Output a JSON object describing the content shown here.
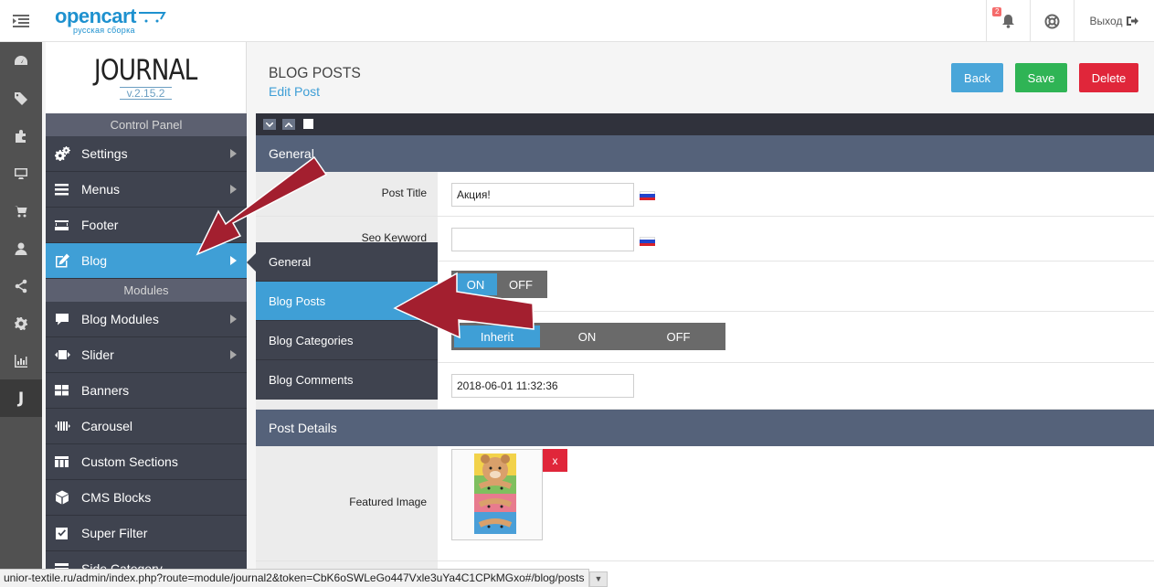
{
  "header": {
    "logo_main": "opencart",
    "logo_sub": "русская сборка",
    "notifications_count": "2",
    "logout_label": "Выход"
  },
  "icon_sidebar": [
    "dashboard-icon",
    "tag-icon",
    "puzzle-icon",
    "monitor-icon",
    "cart-icon",
    "user-icon",
    "share-icon",
    "gear-icon",
    "bar-chart-icon",
    "journal-icon"
  ],
  "journal": {
    "title": "JOURNAL",
    "version": "v.2.15.2",
    "section_control": "Control Panel",
    "section_modules": "Modules",
    "control_items": [
      {
        "label": "Settings",
        "icon": "gears-icon"
      },
      {
        "label": "Menus",
        "icon": "bars-icon"
      },
      {
        "label": "Footer",
        "icon": "footer-icon"
      },
      {
        "label": "Blog",
        "icon": "edit-icon"
      }
    ],
    "module_items": [
      {
        "label": "Blog Modules",
        "icon": "comment-icon"
      },
      {
        "label": "Slider",
        "icon": "slider-icon"
      },
      {
        "label": "Banners",
        "icon": "grid-icon"
      },
      {
        "label": "Carousel",
        "icon": "carousel-icon"
      },
      {
        "label": "Custom Sections",
        "icon": "sections-icon"
      },
      {
        "label": "CMS Blocks",
        "icon": "cube-icon"
      },
      {
        "label": "Super Filter",
        "icon": "checkbox-icon"
      },
      {
        "label": "Side Category",
        "icon": "list-icon"
      }
    ]
  },
  "page": {
    "title": "BLOG POSTS",
    "subtitle": "Edit Post",
    "back_label": "Back",
    "save_label": "Save",
    "delete_label": "Delete"
  },
  "flyout": {
    "items": [
      "General",
      "Blog Posts",
      "Blog Categories",
      "Blog Comments"
    ]
  },
  "general": {
    "heading": "General",
    "post_title_label": "Post Title",
    "post_title_value": "Акция!",
    "seo_label": "Seo Keyword",
    "seo_value": "",
    "status_on": "ON",
    "status_off": "OFF",
    "comments_inherit": "Inherit",
    "comments_on": "ON",
    "comments_off": "OFF",
    "date_value": "2018-06-01 11:32:36"
  },
  "post_details": {
    "heading": "Post Details",
    "featured_image_label": "Featured Image",
    "remove_label": "x"
  },
  "status_url": "unior-textile.ru/admin/index.php?route=module/journal2&token=CbK6oSWLeGo447Vxle3uYa4C1CPkMGxo#/blog/posts",
  "colors": {
    "accent": "#3f9fd6",
    "save": "#2fb455",
    "delete": "#e0263a",
    "arrow": "#a31f2f"
  }
}
